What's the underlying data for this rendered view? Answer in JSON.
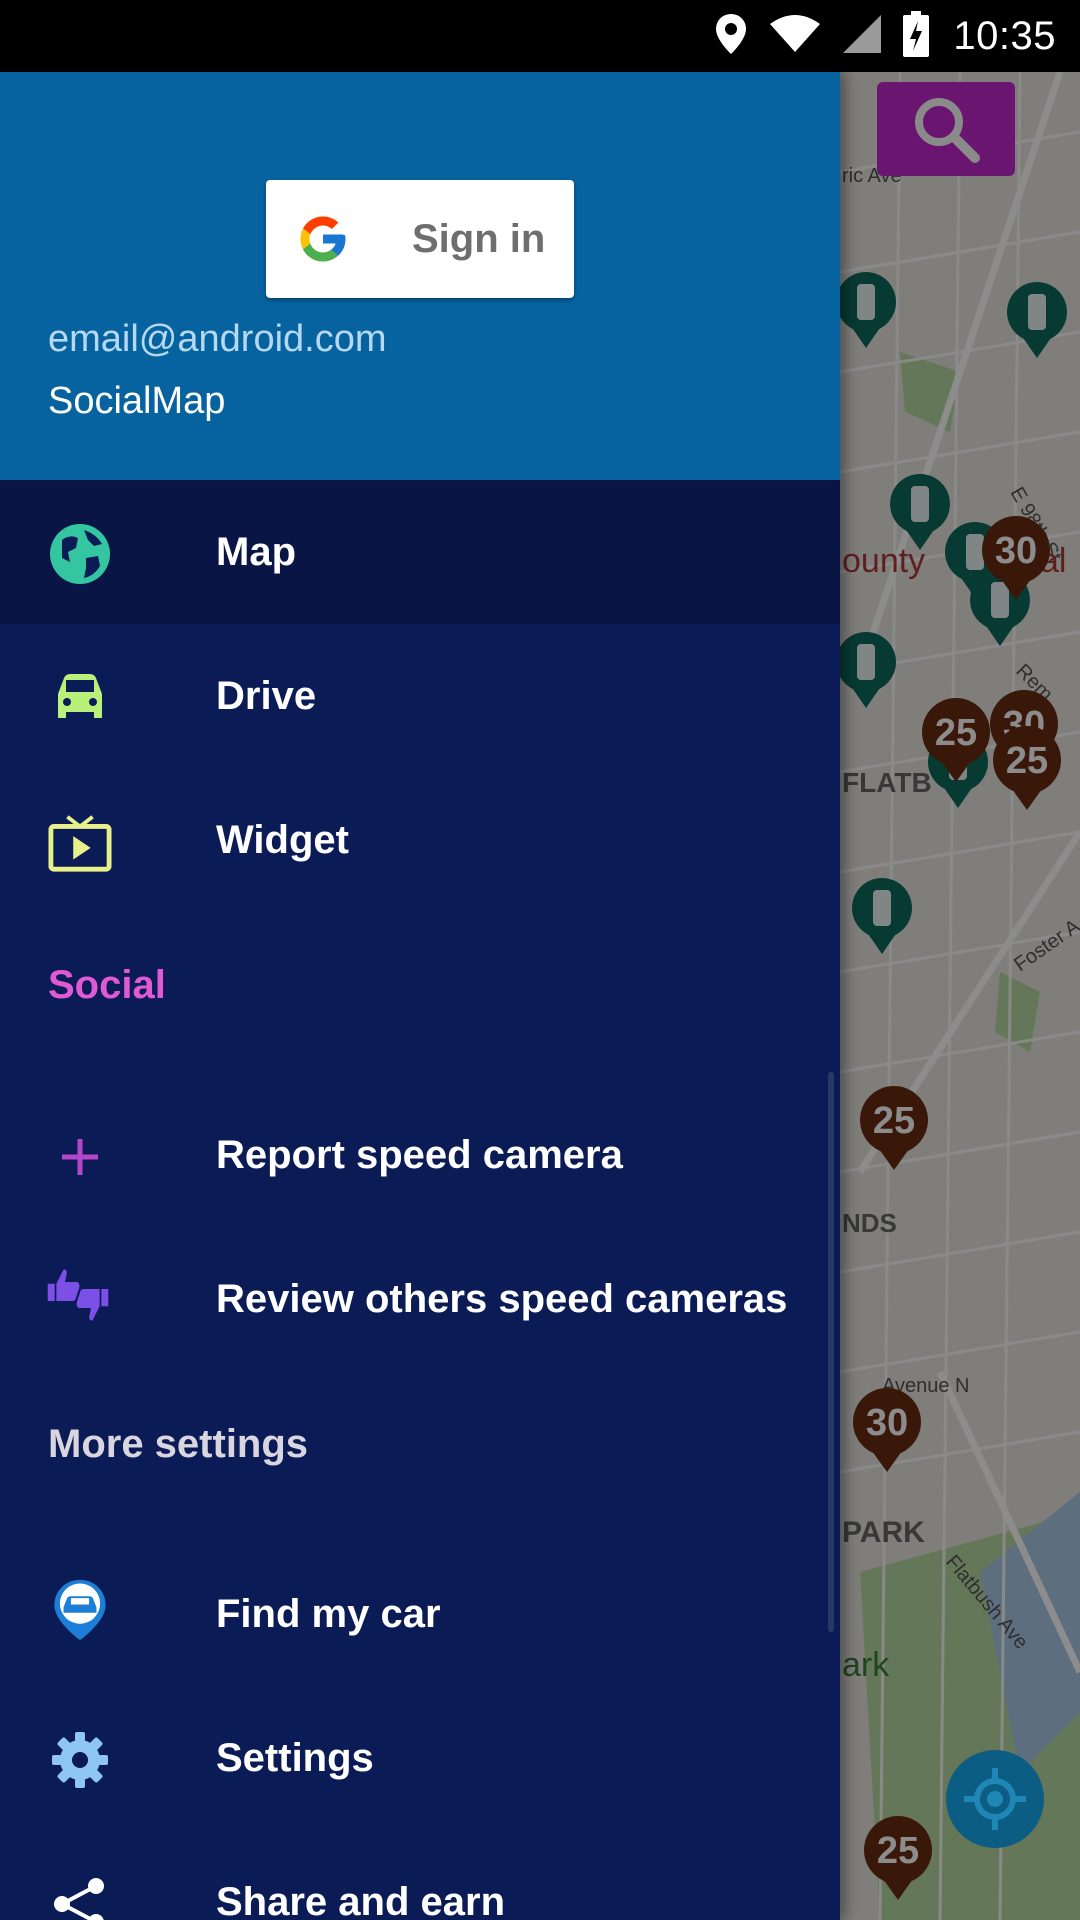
{
  "status_bar": {
    "time": "10:35",
    "icons": [
      "location-icon",
      "wifi-icon",
      "signal-icon",
      "battery-charging-icon"
    ]
  },
  "drawer": {
    "header": {
      "signin_label": "Sign in",
      "email": "email@android.com",
      "app_name": "SocialMap"
    },
    "primary_items": [
      {
        "label": "Map",
        "icon": "globe-icon",
        "selected": true
      },
      {
        "label": "Drive",
        "icon": "car-icon"
      },
      {
        "label": "Widget",
        "icon": "tv-play-icon"
      }
    ],
    "social": {
      "title": "Social",
      "title_color": "#e05ad6",
      "items": [
        {
          "label": "Report speed camera",
          "icon": "plus-icon"
        },
        {
          "label": "Review others speed cameras",
          "icon": "thumbs-up-down-icon"
        }
      ]
    },
    "more_settings": {
      "title": "More settings",
      "items": [
        {
          "label": "Find my car",
          "icon": "car-pin-icon"
        },
        {
          "label": "Settings",
          "icon": "gear-icon"
        },
        {
          "label": "Share and earn",
          "icon": "share-icon"
        }
      ]
    }
  },
  "map": {
    "labels": {
      "street1": "ric Ave",
      "street2": "E 98th St",
      "area1": "ounty",
      "area2": "al",
      "area3": "FLATB",
      "area4": "NDS",
      "street3": "Avenue N",
      "area5": "PARK",
      "street4": "Flatbush Ave",
      "area6": "ark",
      "street5": "Foster A",
      "street6": "Rem"
    },
    "speed_markers": [
      "30",
      "25",
      "30",
      "25",
      "25",
      "30",
      "25"
    ]
  }
}
